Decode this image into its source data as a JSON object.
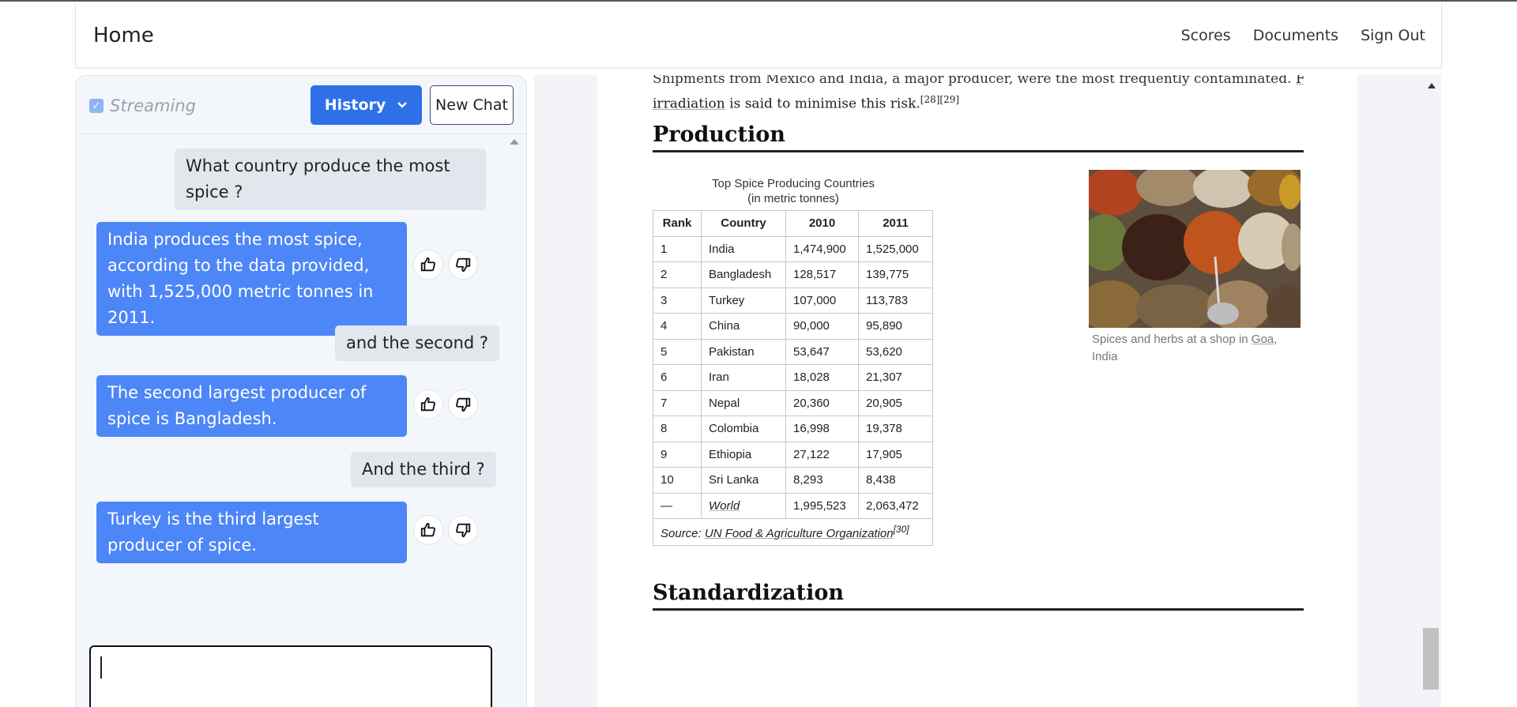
{
  "navbar": {
    "brand": "Home",
    "links": [
      "Scores",
      "Documents",
      "Sign Out"
    ]
  },
  "chat": {
    "streaming_label": "Streaming",
    "streaming_checked": true,
    "history_label": "History",
    "new_chat_label": "New Chat",
    "messages": [
      {
        "role": "user",
        "text": "What country produce the most spice ?"
      },
      {
        "role": "assistant",
        "text": "India produces the most spice, according to the data provided, with 1,525,000 metric tonnes in 2011."
      },
      {
        "role": "user",
        "text": "and the second ?"
      },
      {
        "role": "assistant",
        "text": "The second largest producer of spice is Bangladesh."
      },
      {
        "role": "user",
        "text": "And the third ?"
      },
      {
        "role": "assistant",
        "text": "Turkey is the third largest producer of spice."
      }
    ],
    "input_value": ""
  },
  "document": {
    "clipped_line": "Shipments from Mexico and India, a major producer, were the most frequently contaminated.",
    "clipped_link": "Food",
    "irradiation_link": "irradiation",
    "irradiation_text": " is said to minimise this risk.",
    "irradiation_refs": "[28][29]",
    "heading_production": "Production",
    "heading_standardization": "Standardization",
    "table": {
      "caption_line1": "Top Spice Producing Countries",
      "caption_line2": "(in metric tonnes)",
      "headers": [
        "Rank",
        "Country",
        "2010",
        "2011"
      ],
      "rows": [
        [
          "1",
          "India",
          "1,474,900",
          "1,525,000"
        ],
        [
          "2",
          "Bangladesh",
          "128,517",
          "139,775"
        ],
        [
          "3",
          "Turkey",
          "107,000",
          "113,783"
        ],
        [
          "4",
          "China",
          "90,000",
          "95,890"
        ],
        [
          "5",
          "Pakistan",
          "53,647",
          "53,620"
        ],
        [
          "6",
          "Iran",
          "18,028",
          "21,307"
        ],
        [
          "7",
          "Nepal",
          "20,360",
          "20,905"
        ],
        [
          "8",
          "Colombia",
          "16,998",
          "19,378"
        ],
        [
          "9",
          "Ethiopia",
          "27,122",
          "17,905"
        ],
        [
          "10",
          "Sri Lanka",
          "8,293",
          "8,438"
        ],
        [
          "—",
          "World",
          "1,995,523",
          "2,063,472"
        ]
      ],
      "source_prefix": "Source: ",
      "source_link": "UN Food & Agriculture Organization",
      "source_ref": "[30]"
    },
    "image_caption_prefix": "Spices and herbs at a shop in ",
    "image_caption_link": "Goa",
    "image_caption_suffix": ", India"
  }
}
